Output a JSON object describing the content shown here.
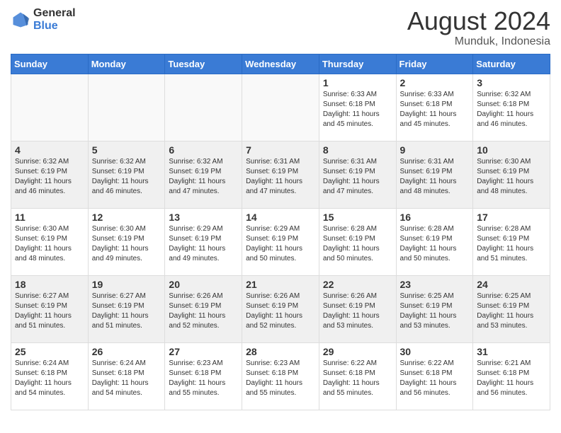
{
  "header": {
    "logo_general": "General",
    "logo_blue": "Blue",
    "month_year": "August 2024",
    "location": "Munduk, Indonesia"
  },
  "weekdays": [
    "Sunday",
    "Monday",
    "Tuesday",
    "Wednesday",
    "Thursday",
    "Friday",
    "Saturday"
  ],
  "weeks": [
    [
      {
        "day": "",
        "info": ""
      },
      {
        "day": "",
        "info": ""
      },
      {
        "day": "",
        "info": ""
      },
      {
        "day": "",
        "info": ""
      },
      {
        "day": "1",
        "info": "Sunrise: 6:33 AM\nSunset: 6:18 PM\nDaylight: 11 hours\nand 45 minutes."
      },
      {
        "day": "2",
        "info": "Sunrise: 6:33 AM\nSunset: 6:18 PM\nDaylight: 11 hours\nand 45 minutes."
      },
      {
        "day": "3",
        "info": "Sunrise: 6:32 AM\nSunset: 6:18 PM\nDaylight: 11 hours\nand 46 minutes."
      }
    ],
    [
      {
        "day": "4",
        "info": "Sunrise: 6:32 AM\nSunset: 6:19 PM\nDaylight: 11 hours\nand 46 minutes."
      },
      {
        "day": "5",
        "info": "Sunrise: 6:32 AM\nSunset: 6:19 PM\nDaylight: 11 hours\nand 46 minutes."
      },
      {
        "day": "6",
        "info": "Sunrise: 6:32 AM\nSunset: 6:19 PM\nDaylight: 11 hours\nand 47 minutes."
      },
      {
        "day": "7",
        "info": "Sunrise: 6:31 AM\nSunset: 6:19 PM\nDaylight: 11 hours\nand 47 minutes."
      },
      {
        "day": "8",
        "info": "Sunrise: 6:31 AM\nSunset: 6:19 PM\nDaylight: 11 hours\nand 47 minutes."
      },
      {
        "day": "9",
        "info": "Sunrise: 6:31 AM\nSunset: 6:19 PM\nDaylight: 11 hours\nand 48 minutes."
      },
      {
        "day": "10",
        "info": "Sunrise: 6:30 AM\nSunset: 6:19 PM\nDaylight: 11 hours\nand 48 minutes."
      }
    ],
    [
      {
        "day": "11",
        "info": "Sunrise: 6:30 AM\nSunset: 6:19 PM\nDaylight: 11 hours\nand 48 minutes."
      },
      {
        "day": "12",
        "info": "Sunrise: 6:30 AM\nSunset: 6:19 PM\nDaylight: 11 hours\nand 49 minutes."
      },
      {
        "day": "13",
        "info": "Sunrise: 6:29 AM\nSunset: 6:19 PM\nDaylight: 11 hours\nand 49 minutes."
      },
      {
        "day": "14",
        "info": "Sunrise: 6:29 AM\nSunset: 6:19 PM\nDaylight: 11 hours\nand 50 minutes."
      },
      {
        "day": "15",
        "info": "Sunrise: 6:28 AM\nSunset: 6:19 PM\nDaylight: 11 hours\nand 50 minutes."
      },
      {
        "day": "16",
        "info": "Sunrise: 6:28 AM\nSunset: 6:19 PM\nDaylight: 11 hours\nand 50 minutes."
      },
      {
        "day": "17",
        "info": "Sunrise: 6:28 AM\nSunset: 6:19 PM\nDaylight: 11 hours\nand 51 minutes."
      }
    ],
    [
      {
        "day": "18",
        "info": "Sunrise: 6:27 AM\nSunset: 6:19 PM\nDaylight: 11 hours\nand 51 minutes."
      },
      {
        "day": "19",
        "info": "Sunrise: 6:27 AM\nSunset: 6:19 PM\nDaylight: 11 hours\nand 51 minutes."
      },
      {
        "day": "20",
        "info": "Sunrise: 6:26 AM\nSunset: 6:19 PM\nDaylight: 11 hours\nand 52 minutes."
      },
      {
        "day": "21",
        "info": "Sunrise: 6:26 AM\nSunset: 6:19 PM\nDaylight: 11 hours\nand 52 minutes."
      },
      {
        "day": "22",
        "info": "Sunrise: 6:26 AM\nSunset: 6:19 PM\nDaylight: 11 hours\nand 53 minutes."
      },
      {
        "day": "23",
        "info": "Sunrise: 6:25 AM\nSunset: 6:19 PM\nDaylight: 11 hours\nand 53 minutes."
      },
      {
        "day": "24",
        "info": "Sunrise: 6:25 AM\nSunset: 6:19 PM\nDaylight: 11 hours\nand 53 minutes."
      }
    ],
    [
      {
        "day": "25",
        "info": "Sunrise: 6:24 AM\nSunset: 6:18 PM\nDaylight: 11 hours\nand 54 minutes."
      },
      {
        "day": "26",
        "info": "Sunrise: 6:24 AM\nSunset: 6:18 PM\nDaylight: 11 hours\nand 54 minutes."
      },
      {
        "day": "27",
        "info": "Sunrise: 6:23 AM\nSunset: 6:18 PM\nDaylight: 11 hours\nand 55 minutes."
      },
      {
        "day": "28",
        "info": "Sunrise: 6:23 AM\nSunset: 6:18 PM\nDaylight: 11 hours\nand 55 minutes."
      },
      {
        "day": "29",
        "info": "Sunrise: 6:22 AM\nSunset: 6:18 PM\nDaylight: 11 hours\nand 55 minutes."
      },
      {
        "day": "30",
        "info": "Sunrise: 6:22 AM\nSunset: 6:18 PM\nDaylight: 11 hours\nand 56 minutes."
      },
      {
        "day": "31",
        "info": "Sunrise: 6:21 AM\nSunset: 6:18 PM\nDaylight: 11 hours\nand 56 minutes."
      }
    ]
  ]
}
